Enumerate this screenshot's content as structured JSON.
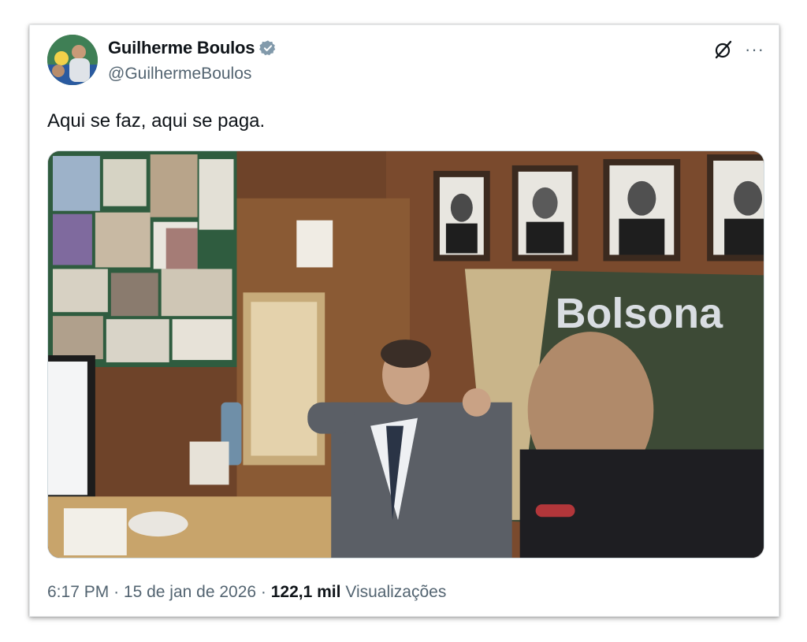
{
  "tweet": {
    "display_name": "Guilherme Boulos",
    "handle": "@GuilhermeBoulos",
    "verified": true,
    "text": "Aqui se faz, aqui se paga.",
    "time": "6:17 PM",
    "separator": "·",
    "date": "15 de jan de 2026",
    "views_count": "122,1 mil",
    "views_label": "Visualizações"
  },
  "media": {
    "banner_text": "Bolsona"
  },
  "icons": {
    "verified": "verified-badge-icon",
    "grok": "grok-icon",
    "more": "more-icon"
  },
  "colors": {
    "primary_text": "#0f1419",
    "secondary_text": "#536471",
    "verified_badge": "#829aab"
  }
}
